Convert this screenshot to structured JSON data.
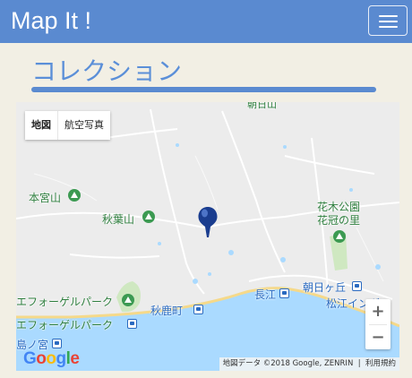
{
  "header": {
    "brand": "Map It !",
    "menu_icon": "hamburger-icon"
  },
  "page": {
    "title": "コレクション"
  },
  "map": {
    "type_control": {
      "map_label": "地図",
      "satellite_label": "航空写真"
    },
    "labels": {
      "hongu_san": "本宮山",
      "akiba_san": "秋葉山",
      "hanaki_park": "花木公園",
      "hanakanmuri": "花冠の里",
      "vogel_park_1": "エフォーゲルパーク",
      "vogel_park_2": "エフォーゲルパーク",
      "akashika_machi": "秋鹿町",
      "nagae": "長江",
      "asahigaoka": "朝日ヶ丘",
      "matsue_ingle": "松江イングリ",
      "shimanomiya": "島ノ宮",
      "top_partial": "朝日山"
    },
    "zoom_in": "+",
    "zoom_out": "−",
    "logo": "Google",
    "attribution": "地図データ ©2018 Google, ZENRIN",
    "terms": "利用規約",
    "marker_icon": "map-pin-icon",
    "colors": {
      "water": "#aadaff",
      "land": "#ececec",
      "park": "#cfe8c1",
      "road": "#ffffff",
      "marker": "#1a3d8f"
    }
  }
}
